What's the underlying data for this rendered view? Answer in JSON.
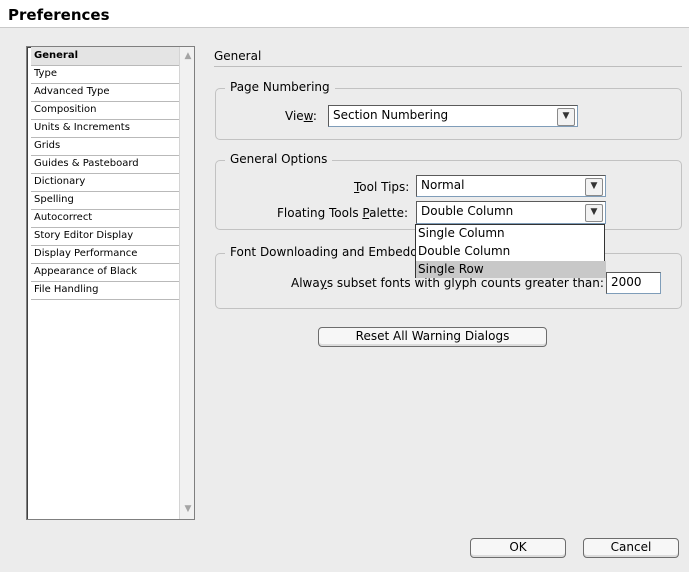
{
  "window": {
    "title": "Preferences"
  },
  "sidebar": {
    "items": [
      "General",
      "Type",
      "Advanced Type",
      "Composition",
      "Units & Increments",
      "Grids",
      "Guides & Pasteboard",
      "Dictionary",
      "Spelling",
      "Autocorrect",
      "Story Editor Display",
      "Display Performance",
      "Appearance of Black",
      "File Handling"
    ],
    "selected": "General"
  },
  "main": {
    "title": "General",
    "page_numbering": {
      "legend": "Page Numbering",
      "view_label_pre": "Vie",
      "view_label_ul": "w",
      "view_label_post": ":",
      "view_value": "Section Numbering"
    },
    "general_options": {
      "legend": "General Options",
      "tooltips_label_ul": "T",
      "tooltips_label_post": "ool Tips:",
      "tooltips_value": "Normal",
      "palette_label_pre": "Floating Tools ",
      "palette_label_ul": "P",
      "palette_label_post": "alette:",
      "palette_value": "Double Column",
      "palette_options": [
        "Single Column",
        "Double Column",
        "Single Row"
      ],
      "palette_highlighted": "Single Row"
    },
    "font_downloading": {
      "legend": "Font Downloading and Embedd",
      "subset_label_pre": "Alwa",
      "subset_label_ul": "y",
      "subset_label_post": "s subset fonts with glyph counts greater than:",
      "subset_value": "2000"
    },
    "reset_label": "Reset All Warning Dialogs"
  },
  "footer": {
    "ok_label": "OK",
    "cancel_label": "Cancel"
  },
  "icons": {
    "dropdown": "chevron-down-icon",
    "scroll_up": "scroll-up-arrow-icon",
    "scroll_down": "scroll-down-arrow-icon"
  },
  "colors": {
    "dialog_bg": "#ececec",
    "selection_bg": "#e4e4e4",
    "highlight_bg": "#c8c8c8"
  }
}
